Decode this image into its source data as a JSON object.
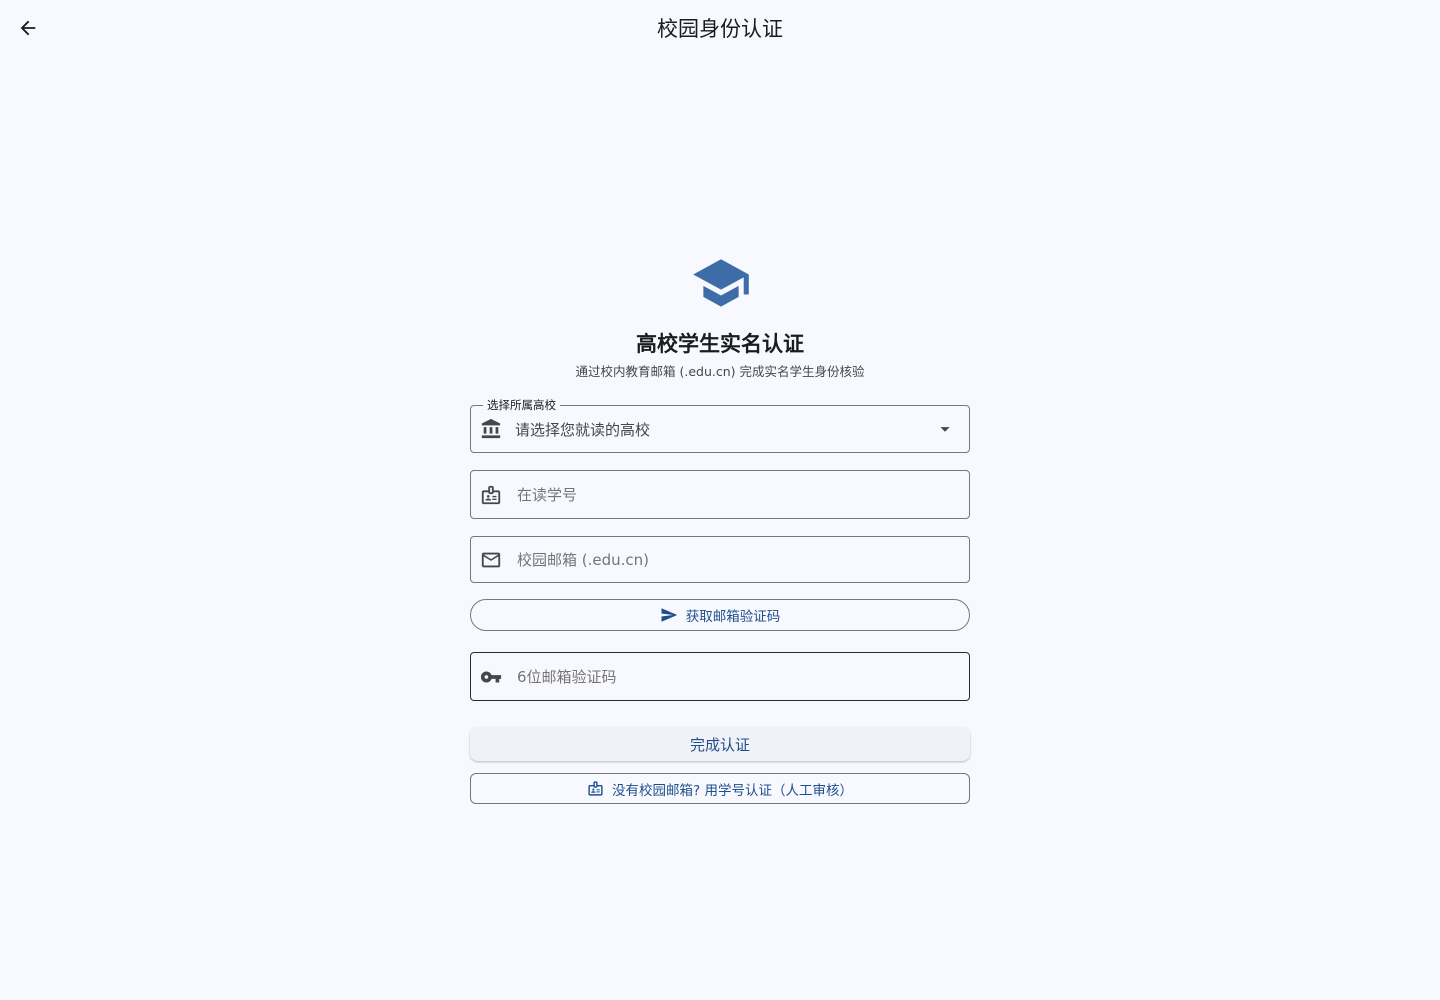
{
  "app_bar": {
    "title": "校园身份认证",
    "back_icon": "arrow-back-icon"
  },
  "hero": {
    "icon": "graduation-cap-icon",
    "title": "高校学生实名认证",
    "subtitle": "通过校内教育邮箱 (.edu.cn) 完成实名学生身份核验"
  },
  "form": {
    "school": {
      "label": "选择所属高校",
      "placeholder": "请选择您就读的高校",
      "icon": "institution-icon"
    },
    "student_id": {
      "placeholder": "在读学号",
      "icon": "badge-icon"
    },
    "email": {
      "placeholder": "校园邮箱 (.edu.cn)",
      "icon": "mail-icon"
    },
    "send_code": {
      "label": "获取邮箱验证码",
      "icon": "send-icon"
    },
    "code": {
      "placeholder": "6位邮箱验证码",
      "icon": "key-icon"
    },
    "submit": {
      "label": "完成认证"
    },
    "manual": {
      "label": "没有校园邮箱? 用学号认证（人工审核）",
      "icon": "badge-icon"
    }
  },
  "colors": {
    "accent": "#1f4e8c",
    "icon_blue": "#3d6ca8",
    "background": "#f8f9fe"
  }
}
